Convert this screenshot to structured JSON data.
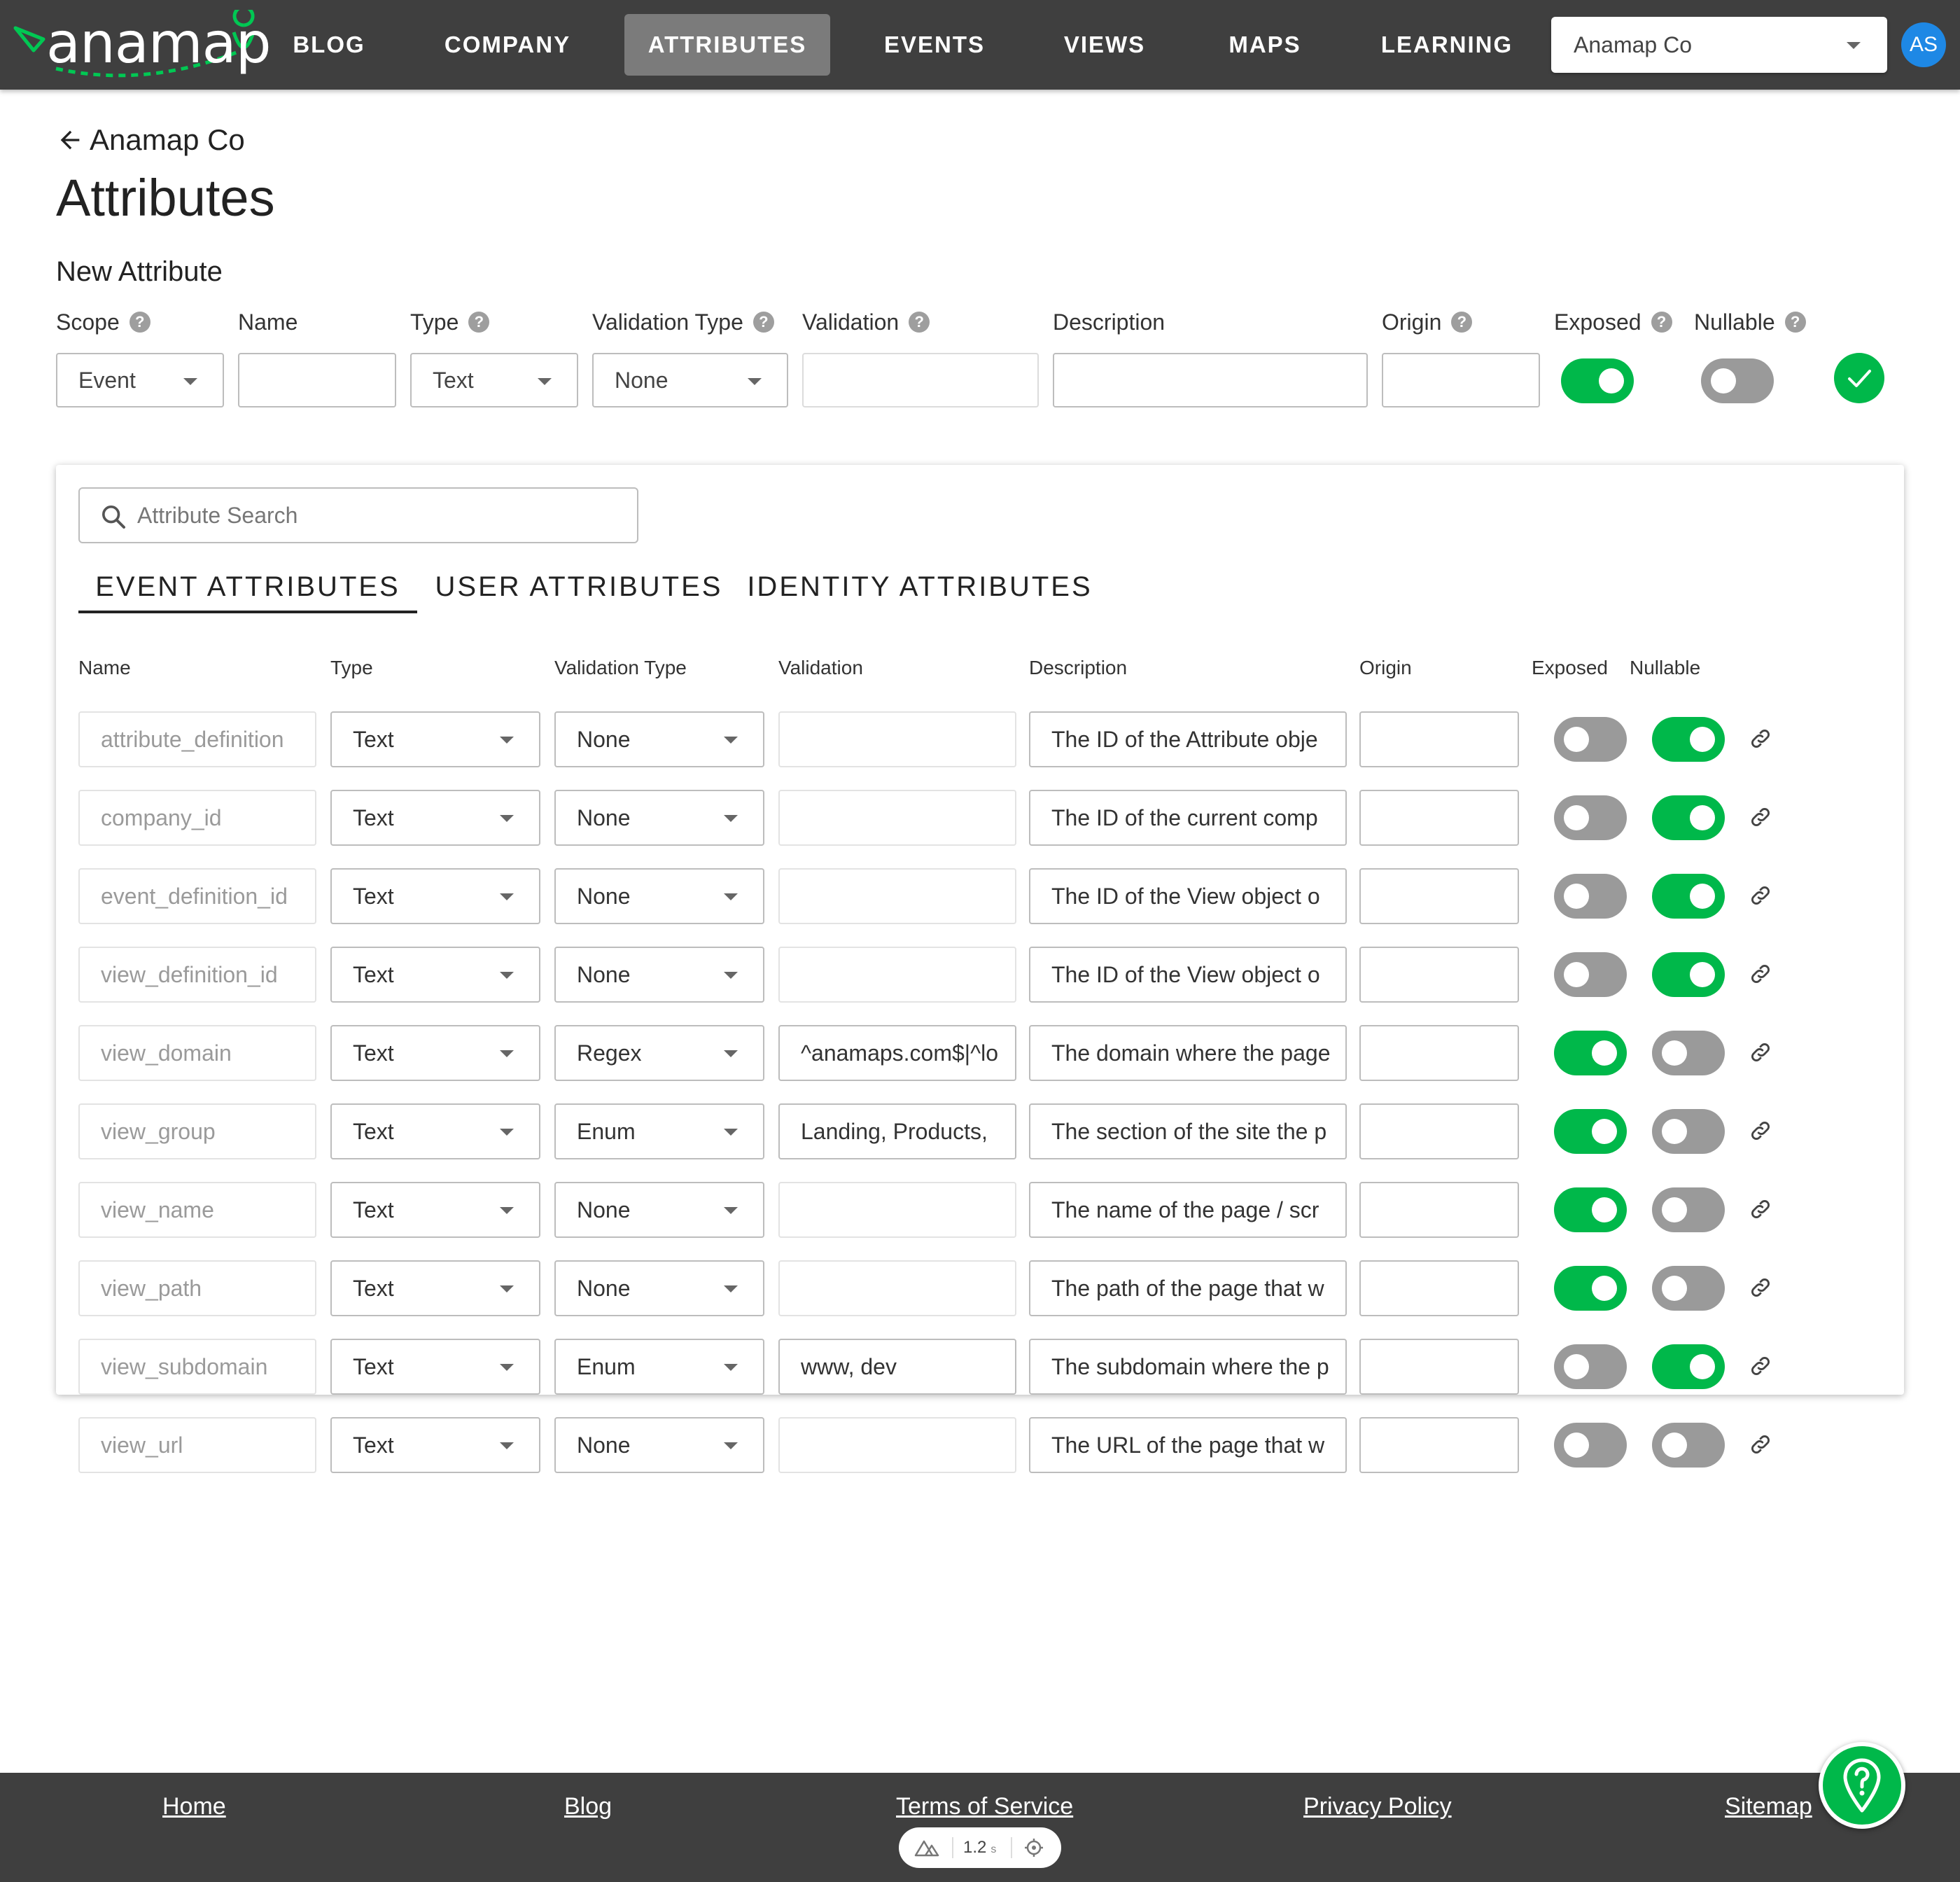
{
  "brand": {
    "logo_text": "anamap",
    "accent_color": "#00b84a",
    "nav_bg": "#3f3f3f"
  },
  "nav": {
    "items": [
      {
        "label": "BLOG"
      },
      {
        "label": "COMPANY"
      },
      {
        "label": "ATTRIBUTES",
        "active": true
      },
      {
        "label": "EVENTS"
      },
      {
        "label": "VIEWS"
      },
      {
        "label": "MAPS"
      },
      {
        "label": "LEARNING"
      }
    ],
    "company_select": "Anamap Co",
    "avatar": "AS"
  },
  "header": {
    "back_label": "Anamap Co",
    "title": "Attributes",
    "section_title": "New Attribute"
  },
  "new_attribute": {
    "labels": {
      "scope": "Scope",
      "name": "Name",
      "type": "Type",
      "validation_type": "Validation Type",
      "validation": "Validation",
      "description": "Description",
      "origin": "Origin",
      "exposed": "Exposed",
      "nullable": "Nullable"
    },
    "help_glyph": "?",
    "scope": "Event",
    "name": "",
    "type": "Text",
    "validation_type": "None",
    "validation": "",
    "description": "",
    "origin": "",
    "exposed": true,
    "nullable": false
  },
  "search": {
    "placeholder": "Attribute Search"
  },
  "tabs": [
    {
      "label": "EVENT ATTRIBUTES",
      "active": true
    },
    {
      "label": "USER ATTRIBUTES"
    },
    {
      "label": "IDENTITY ATTRIBUTES"
    }
  ],
  "table": {
    "columns": [
      "Name",
      "Type",
      "Validation Type",
      "Validation",
      "Description",
      "Origin",
      "Exposed",
      "Nullable"
    ],
    "rows": [
      {
        "name": "attribute_definition",
        "type": "Text",
        "validation_type": "None",
        "validation": "",
        "description": "The ID of the Attribute obje",
        "origin": "",
        "exposed": false,
        "nullable": true
      },
      {
        "name": "company_id",
        "type": "Text",
        "validation_type": "None",
        "validation": "",
        "description": "The ID of the current comp",
        "origin": "",
        "exposed": false,
        "nullable": true
      },
      {
        "name": "event_definition_id",
        "type": "Text",
        "validation_type": "None",
        "validation": "",
        "description": "The ID of the View object o",
        "origin": "",
        "exposed": false,
        "nullable": true
      },
      {
        "name": "view_definition_id",
        "type": "Text",
        "validation_type": "None",
        "validation": "",
        "description": "The ID of the View object o",
        "origin": "",
        "exposed": false,
        "nullable": true
      },
      {
        "name": "view_domain",
        "type": "Text",
        "validation_type": "Regex",
        "validation": "^anamaps.com$|^lo",
        "description": "The domain where the page",
        "origin": "",
        "exposed": true,
        "nullable": false
      },
      {
        "name": "view_group",
        "type": "Text",
        "validation_type": "Enum",
        "validation": "Landing, Products,",
        "description": "The section of the site the p",
        "origin": "",
        "exposed": true,
        "nullable": false
      },
      {
        "name": "view_name",
        "type": "Text",
        "validation_type": "None",
        "validation": "",
        "description": "The name of the page / scr",
        "origin": "",
        "exposed": true,
        "nullable": false
      },
      {
        "name": "view_path",
        "type": "Text",
        "validation_type": "None",
        "validation": "",
        "description": "The path of the page that w",
        "origin": "",
        "exposed": true,
        "nullable": false
      },
      {
        "name": "view_subdomain",
        "type": "Text",
        "validation_type": "Enum",
        "validation": "www, dev",
        "description": "The subdomain where the p",
        "origin": "",
        "exposed": false,
        "nullable": true
      },
      {
        "name": "view_url",
        "type": "Text",
        "validation_type": "None",
        "validation": "",
        "description": "The URL of the page that w",
        "origin": "",
        "exposed": false,
        "nullable": false
      }
    ]
  },
  "footer": {
    "links": [
      "Home",
      "Blog",
      "Terms of Service",
      "Privacy Policy",
      "Sitemap"
    ],
    "perf_value": "1.2",
    "perf_unit": "s"
  }
}
